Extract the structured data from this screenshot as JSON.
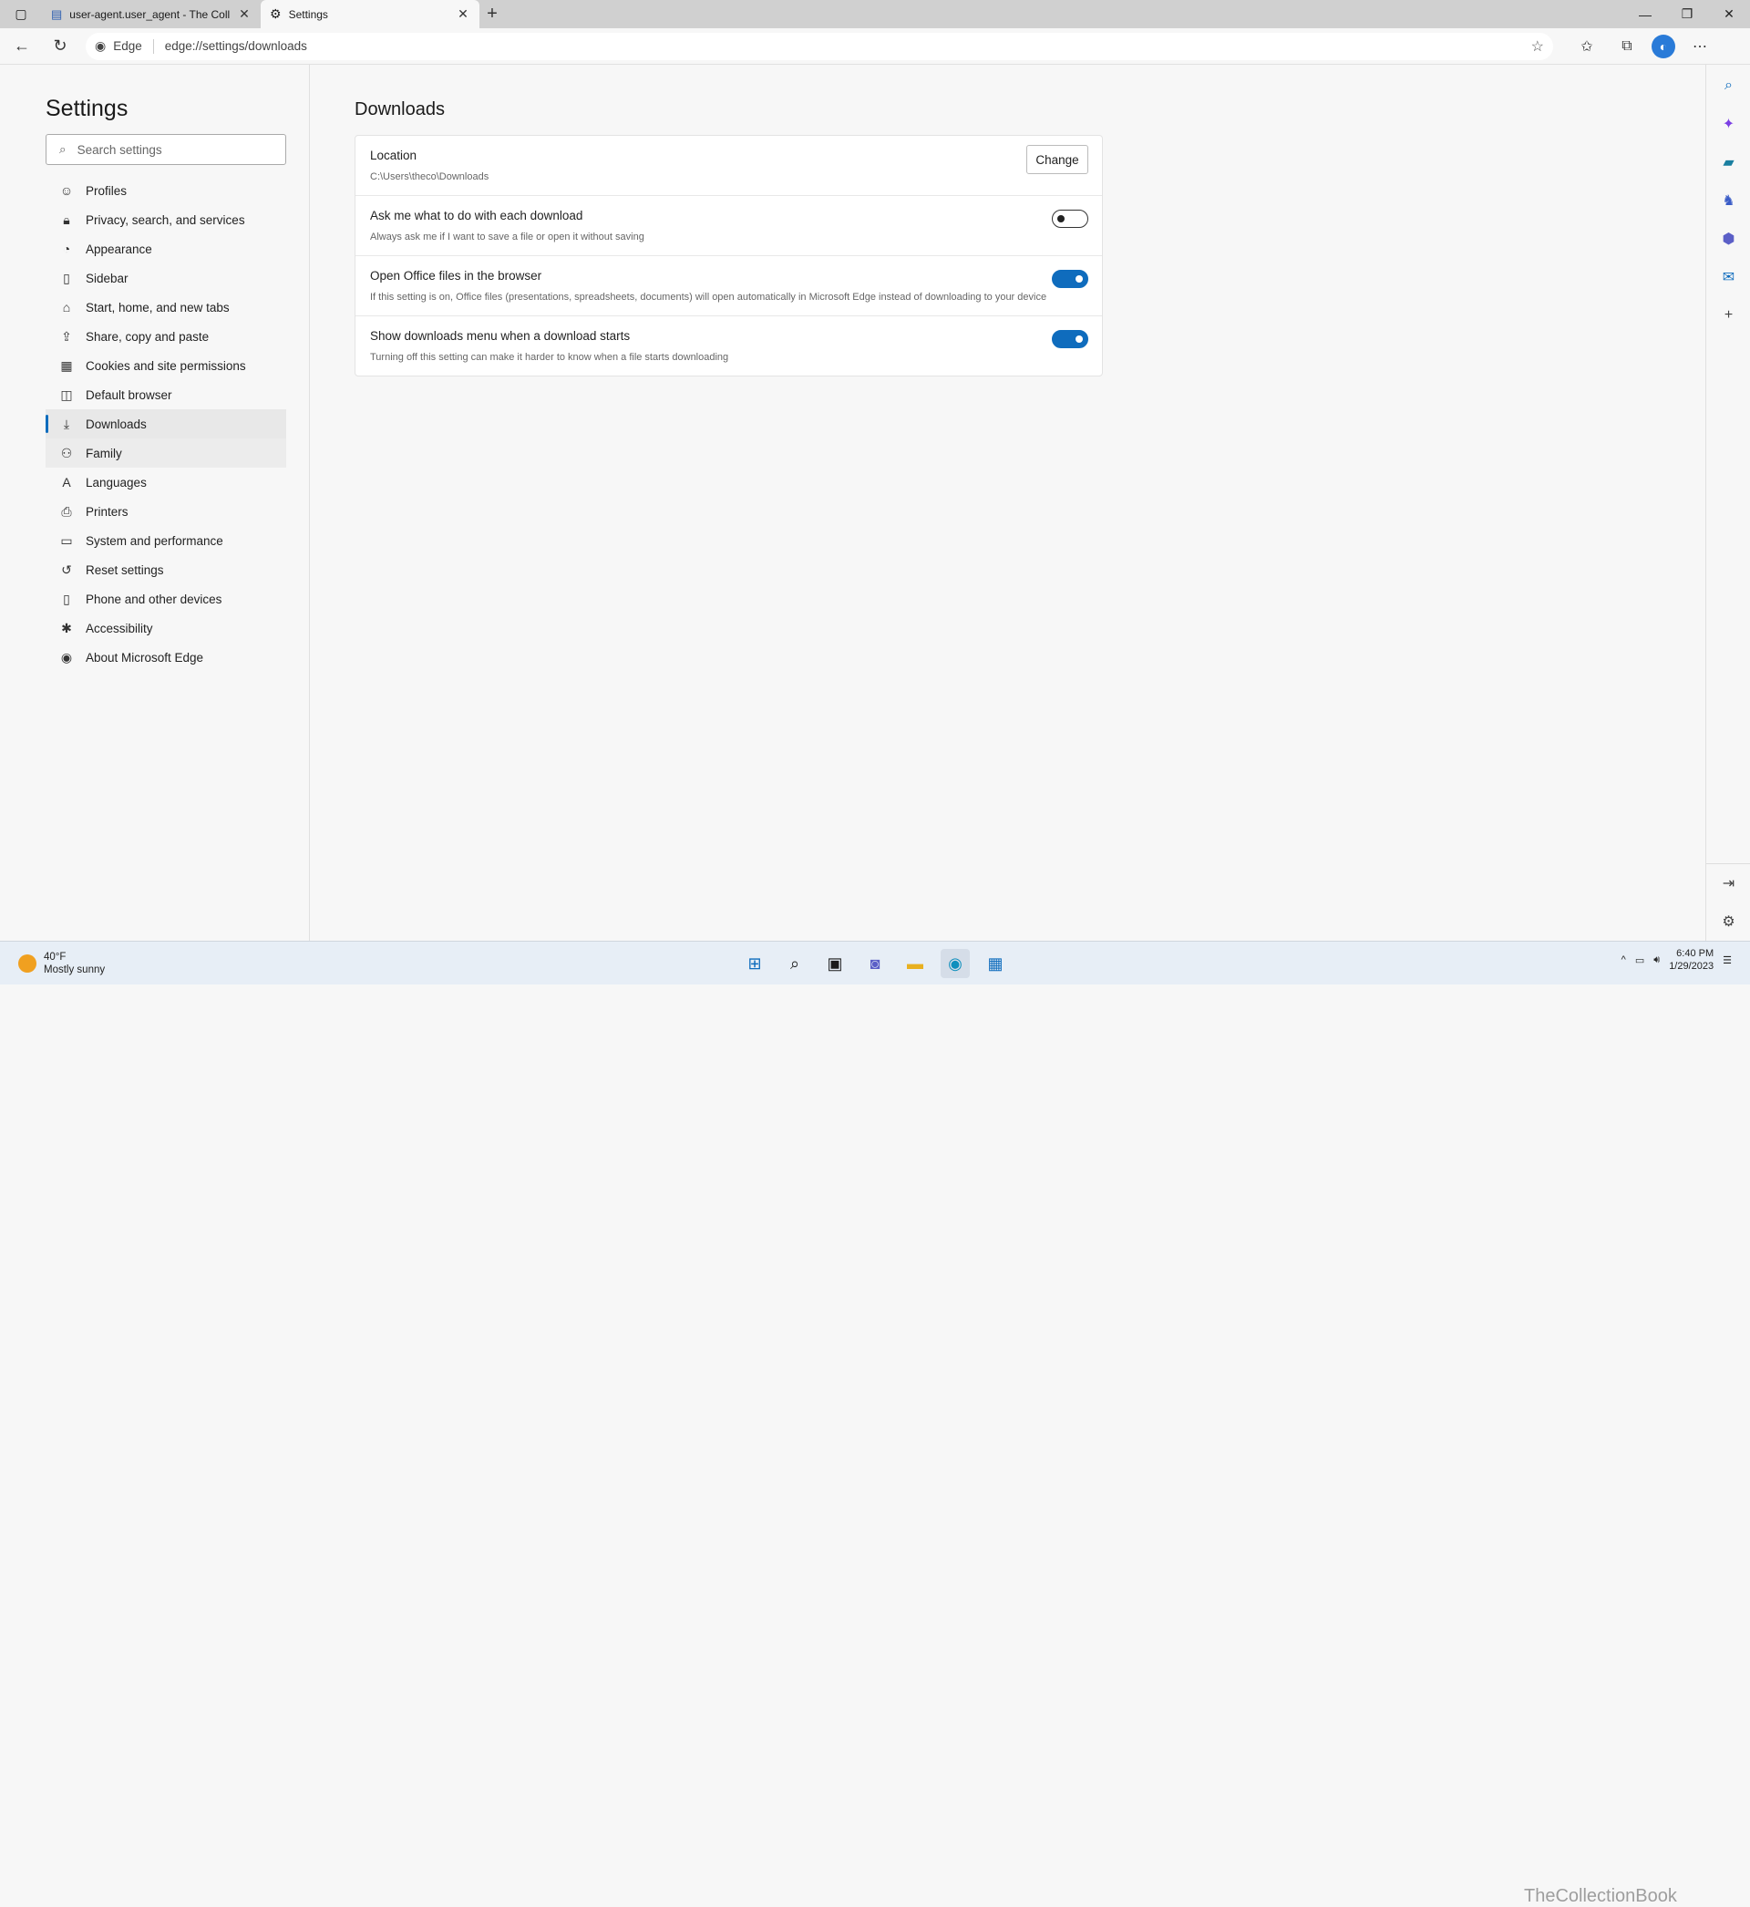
{
  "tabs": [
    {
      "title": "user-agent.user_agent - The Coll",
      "active": false
    },
    {
      "title": "Settings",
      "active": true
    }
  ],
  "toolbar": {
    "site_label": "Edge",
    "url": "edge://settings/downloads"
  },
  "sidebar": {
    "title": "Settings",
    "search_placeholder": "Search settings",
    "items": [
      {
        "label": "Profiles",
        "icon": "profile-icon"
      },
      {
        "label": "Privacy, search, and services",
        "icon": "lock-icon"
      },
      {
        "label": "Appearance",
        "icon": "appearance-icon"
      },
      {
        "label": "Sidebar",
        "icon": "sidebar-icon"
      },
      {
        "label": "Start, home, and new tabs",
        "icon": "home-icon"
      },
      {
        "label": "Share, copy and paste",
        "icon": "share-icon"
      },
      {
        "label": "Cookies and site permissions",
        "icon": "cookies-icon"
      },
      {
        "label": "Default browser",
        "icon": "browser-icon"
      },
      {
        "label": "Downloads",
        "icon": "download-icon"
      },
      {
        "label": "Family",
        "icon": "family-icon"
      },
      {
        "label": "Languages",
        "icon": "languages-icon"
      },
      {
        "label": "Printers",
        "icon": "printer-icon"
      },
      {
        "label": "System and performance",
        "icon": "laptop-icon"
      },
      {
        "label": "Reset settings",
        "icon": "reset-icon"
      },
      {
        "label": "Phone and other devices",
        "icon": "phone-icon"
      },
      {
        "label": "Accessibility",
        "icon": "accessibility-icon"
      },
      {
        "label": "About Microsoft Edge",
        "icon": "edge-icon"
      }
    ]
  },
  "main": {
    "title": "Downloads",
    "location": {
      "label": "Location",
      "path": "C:\\Users\\theco\\Downloads",
      "button": "Change"
    },
    "settings": [
      {
        "label": "Ask me what to do with each download",
        "desc": "Always ask me if I want to save a file or open it without saving",
        "on": false
      },
      {
        "label": "Open Office files in the browser",
        "desc": "If this setting is on, Office files (presentations, spreadsheets, documents) will open automatically in Microsoft Edge instead of downloading to your device",
        "on": true
      },
      {
        "label": "Show downloads menu when a download starts",
        "desc": "Turning off this setting can make it harder to know when a file starts downloading",
        "on": true
      }
    ]
  },
  "taskbar": {
    "temperature": "40°F",
    "weather": "Mostly sunny",
    "time": "6:40 PM",
    "date": "1/29/2023",
    "watermark": "TheCollectionBook"
  },
  "colors": {
    "accent": "#0f6cbd"
  }
}
